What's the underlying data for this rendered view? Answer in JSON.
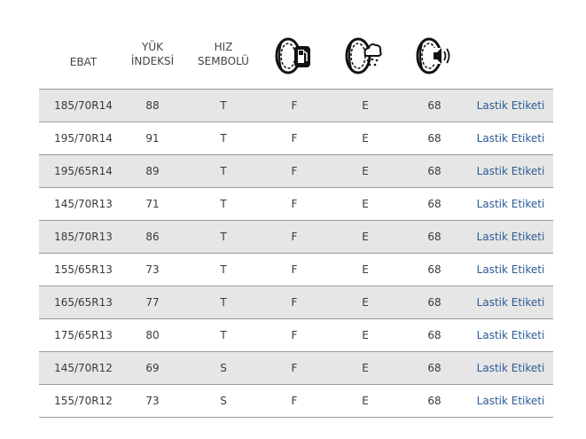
{
  "header": {
    "ebat": "EBAT",
    "yuk_line1": "YÜK",
    "yuk_line2": "İNDEKSİ",
    "hiz_line1": "HIZ",
    "hiz_line2": "SEMBOLÜ",
    "icons": [
      "tire-fuel-icon",
      "tire-wet-grip-icon",
      "tire-noise-icon"
    ]
  },
  "colors": {
    "stripe": "#e6e6e6",
    "link": "#2a5b96",
    "border": "#9a9a9a"
  },
  "rows": [
    {
      "ebat": "185/70R14",
      "yuk": "88",
      "hiz": "T",
      "fuel": "F",
      "wet": "E",
      "noise": "68",
      "link": "Lastik Etiketi"
    },
    {
      "ebat": "195/70R14",
      "yuk": "91",
      "hiz": "T",
      "fuel": "F",
      "wet": "E",
      "noise": "68",
      "link": "Lastik Etiketi"
    },
    {
      "ebat": "195/65R14",
      "yuk": "89",
      "hiz": "T",
      "fuel": "F",
      "wet": "E",
      "noise": "68",
      "link": "Lastik Etiketi"
    },
    {
      "ebat": "145/70R13",
      "yuk": "71",
      "hiz": "T",
      "fuel": "F",
      "wet": "E",
      "noise": "68",
      "link": "Lastik Etiketi"
    },
    {
      "ebat": "185/70R13",
      "yuk": "86",
      "hiz": "T",
      "fuel": "F",
      "wet": "E",
      "noise": "68",
      "link": "Lastik Etiketi"
    },
    {
      "ebat": "155/65R13",
      "yuk": "73",
      "hiz": "T",
      "fuel": "F",
      "wet": "E",
      "noise": "68",
      "link": "Lastik Etiketi"
    },
    {
      "ebat": "165/65R13",
      "yuk": "77",
      "hiz": "T",
      "fuel": "F",
      "wet": "E",
      "noise": "68",
      "link": "Lastik Etiketi"
    },
    {
      "ebat": "175/65R13",
      "yuk": "80",
      "hiz": "T",
      "fuel": "F",
      "wet": "E",
      "noise": "68",
      "link": "Lastik Etiketi"
    },
    {
      "ebat": "145/70R12",
      "yuk": "69",
      "hiz": "S",
      "fuel": "F",
      "wet": "E",
      "noise": "68",
      "link": "Lastik Etiketi"
    },
    {
      "ebat": "155/70R12",
      "yuk": "73",
      "hiz": "S",
      "fuel": "F",
      "wet": "E",
      "noise": "68",
      "link": "Lastik Etiketi"
    }
  ]
}
